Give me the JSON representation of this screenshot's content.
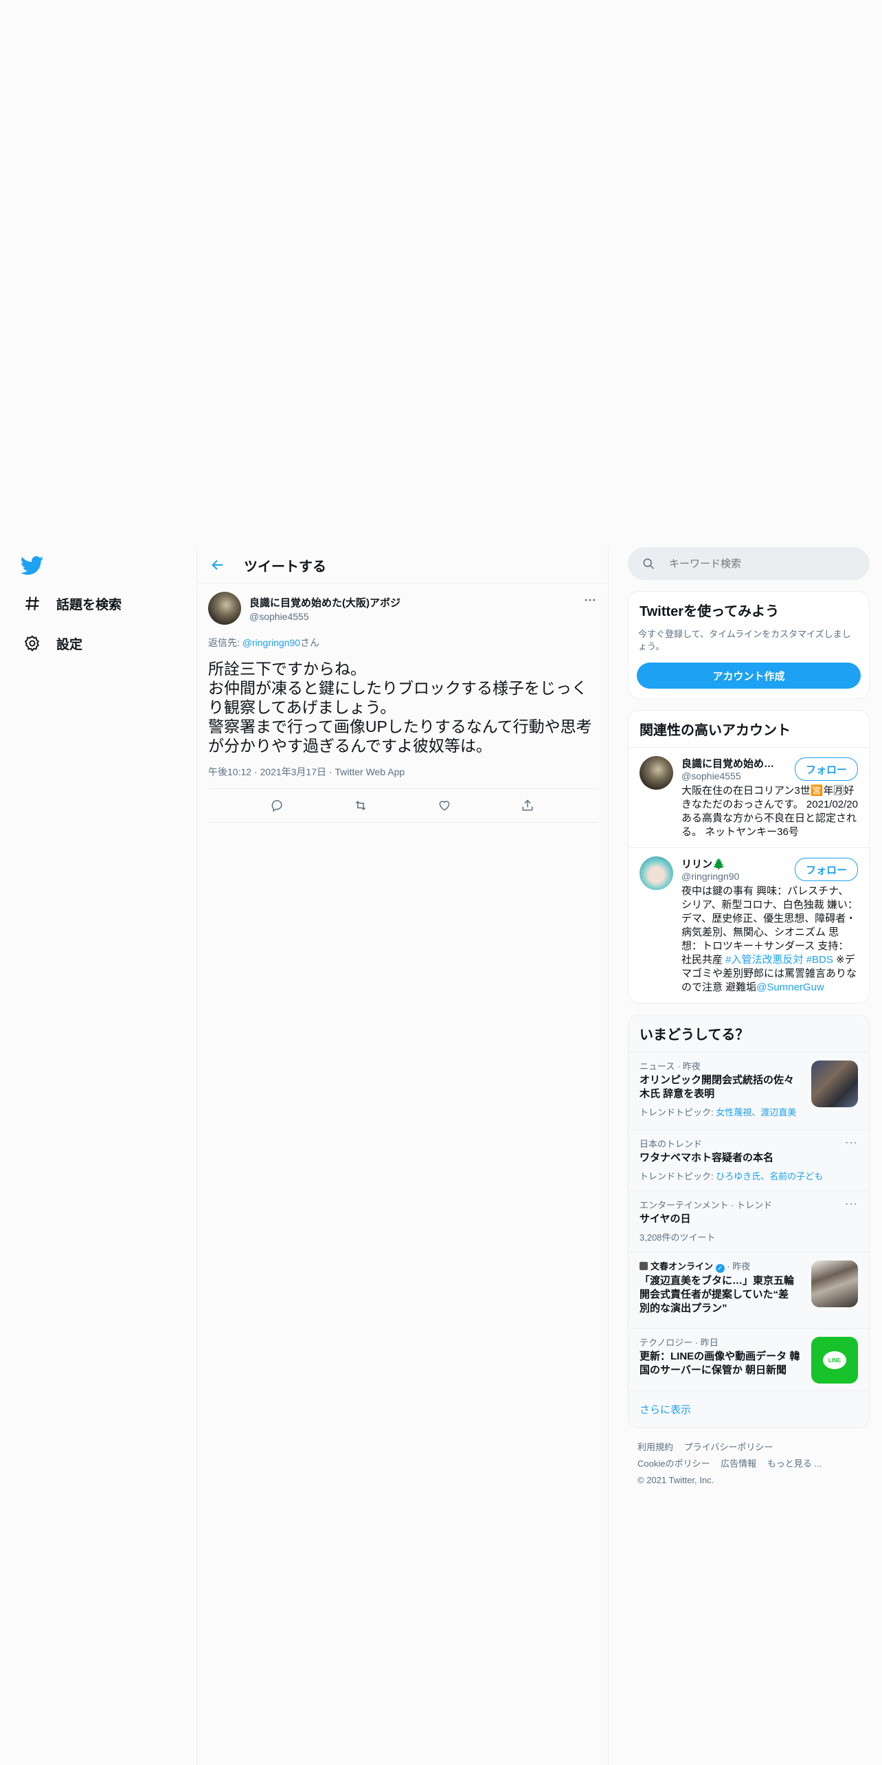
{
  "nav": {
    "items": [
      {
        "label": "話題を検索",
        "icon": "hashtag-icon"
      },
      {
        "label": "設定",
        "icon": "gear-icon"
      }
    ]
  },
  "header": {
    "title": "ツイートする"
  },
  "tweet": {
    "name": "良識に目覚め始めた(大阪)アボジ",
    "handle": "@sophie4555",
    "reply_prefix": "返信先: ",
    "reply_handle": "@ringringn90",
    "reply_suffix": "さん",
    "text": "所詮三下ですからね。\nお仲間が凍ると鍵にしたりブロックする様子をじっくり観察してあげましょう。\n警察署まで行って画像UPしたりするなんて行動や思考が分かりやす過ぎるんですよ彼奴等は。",
    "time": "午後10:12",
    "date": "2021年3月17日",
    "source": "Twitter Web App",
    "more": "···"
  },
  "search": {
    "placeholder": "キーワード検索"
  },
  "signup": {
    "title": "Twitterを使ってみよう",
    "desc": "今すぐ登録して、タイムラインをカスタマイズしましょう。",
    "button": "アカウント作成"
  },
  "related": {
    "title": "関連性の高いアカウント",
    "follow_label": "フォロー",
    "accounts": [
      {
        "name": "良識に目覚め始めた(大阪)アボジ",
        "handle": "@sophie4555",
        "bio": "大阪在住の在日コリアン3世🈺年🈷好きなただのおっさんです。 2021/02/20 ある高貴な方から不良在日と認定される。 ネットヤンキー36号"
      },
      {
        "name": "リリン🌲",
        "handle": "@ringringn90",
        "bio_text": "夜中は鍵の事有 興味：パレスチナ、シリア、新型コロナ、白色独裁 嫌い：デマ、歴史修正、優生思想、障碍者・病気差別、無関心、シオニズム 思想：トロツキー＋サンダース 支持：社民共産 ",
        "bio_tag1": "#入管法改悪反対",
        "bio_tag2": "#BDS",
        "bio_text2": " ※デマゴミや差別野郎には罵詈雑言ありなので注意 避難垢",
        "bio_link": "@SumnerGuw"
      }
    ]
  },
  "trends": {
    "title": "いまどうしてる？",
    "items": [
      {
        "meta": "ニュース · 昨夜",
        "title": "オリンピック開閉会式統括の佐々木氏 辞意を表明",
        "sub_prefix": "トレンドトピック: ",
        "sub_links": "女性蔑視、渡辺直美"
      },
      {
        "meta": "日本のトレンド",
        "title": "ワタナベマホト容疑者の本名",
        "sub_prefix": "トレンドトピック: ",
        "sub_links": "ひろゆき氏、名前の子ども"
      },
      {
        "meta": "エンターテインメント · トレンド",
        "title": "サイヤの日",
        "sub": "3,208件のツイート"
      },
      {
        "meta_name": "文春オンライン",
        "meta_time": " · 昨夜",
        "title": "「渡辺直美をブタに…」東京五輪開会式責任者が提案していた“差別的な演出プラン”"
      },
      {
        "meta": "テクノロジー · 昨日",
        "title": "更新：LINEの画像や動画データ 韓国のサーバーに保管か 朝日新聞"
      }
    ],
    "show_more": "さらに表示"
  },
  "footer": {
    "links": [
      "利用規約",
      "プライバシーポリシー",
      "Cookieのポリシー",
      "広告情報",
      "もっと見る ..."
    ],
    "copyright": "© 2021 Twitter, Inc."
  },
  "colors": {
    "accent": "#1da1f2",
    "secondary_text": "#5b7083",
    "border": "#ebeef0"
  }
}
